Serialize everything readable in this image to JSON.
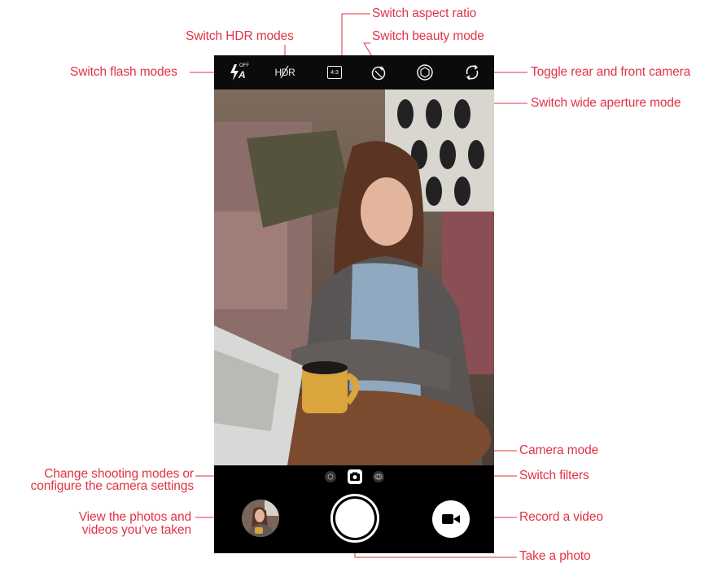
{
  "topbar": {
    "flash_icon": "flash-auto-icon",
    "flash_off_text": "OFF",
    "flash_a_text": "A",
    "hdr_icon": "hdr-off-icon",
    "hdr_text": "HDR",
    "aspect_icon": "aspect-ratio-icon",
    "aspect_text": "4:3",
    "beauty_icon": "beauty-mode-icon",
    "aperture_icon": "aperture-icon",
    "switch_camera_icon": "switch-camera-icon"
  },
  "modes": {
    "settings_icon": "shooting-modes-icon",
    "camera_icon": "camera-mode-icon",
    "filter_icon": "filter-icon"
  },
  "bottom": {
    "gallery_icon": "gallery-thumbnail",
    "shutter_icon": "shutter-icon",
    "video_icon": "video-camera-icon"
  },
  "annotations": {
    "aspect": "Switch aspect ratio",
    "hdr": "Switch HDR modes",
    "beauty": "Switch beauty mode",
    "flash": "Switch flash modes",
    "toggle": "Toggle rear and front camera",
    "aperture": "Switch wide aperture mode",
    "camera_mode": "Camera mode",
    "shooting_line1": "Change shooting modes or",
    "shooting_line2": "configure the camera settings",
    "filters": "Switch filters",
    "gallery_line1": "View the photos and",
    "gallery_line2": "videos you’ve taken",
    "record": "Record a video",
    "photo": "Take a photo"
  },
  "colors": {
    "annotation": "#e03344",
    "screen_bg": "#000000",
    "icon": "#f2f2f2"
  }
}
